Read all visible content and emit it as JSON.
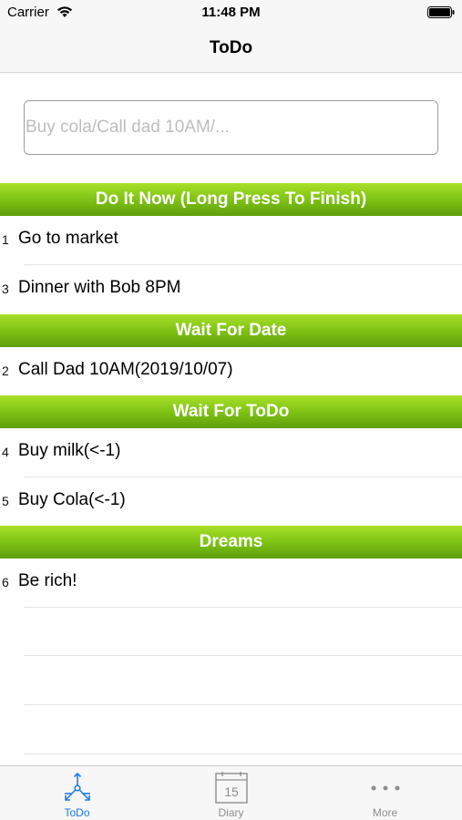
{
  "status_bar": {
    "carrier": "Carrier",
    "time": "11:48 PM"
  },
  "nav": {
    "title": "ToDo"
  },
  "input": {
    "value": "",
    "placeholder": "Buy cola/Call dad 10AM/..."
  },
  "sections": [
    {
      "title": "Do It Now (Long Press To Finish)",
      "items": [
        {
          "num": "1",
          "text": "Go to market"
        },
        {
          "num": "3",
          "text": "Dinner with Bob 8PM"
        }
      ]
    },
    {
      "title": "Wait For Date",
      "items": [
        {
          "num": "2",
          "text": "Call Dad 10AM(2019/10/07)"
        }
      ]
    },
    {
      "title": "Wait For ToDo",
      "items": [
        {
          "num": "4",
          "text": "Buy milk(<-1)"
        },
        {
          "num": "5",
          "text": "Buy Cola(<-1)"
        }
      ]
    },
    {
      "title": "Dreams",
      "items": [
        {
          "num": "6",
          "text": "Be rich!"
        }
      ]
    }
  ],
  "tabs": [
    {
      "label": "ToDo",
      "icon": "todo-tree-icon",
      "active": true
    },
    {
      "label": "Diary",
      "icon": "calendar-icon",
      "calendar_day": "15",
      "active": false
    },
    {
      "label": "More",
      "icon": "more-dots-icon",
      "active": false
    }
  ],
  "colors": {
    "accent": "#1a7cf2",
    "section_header_green": "#7ec314",
    "inactive_tab": "#8e8e8e"
  }
}
